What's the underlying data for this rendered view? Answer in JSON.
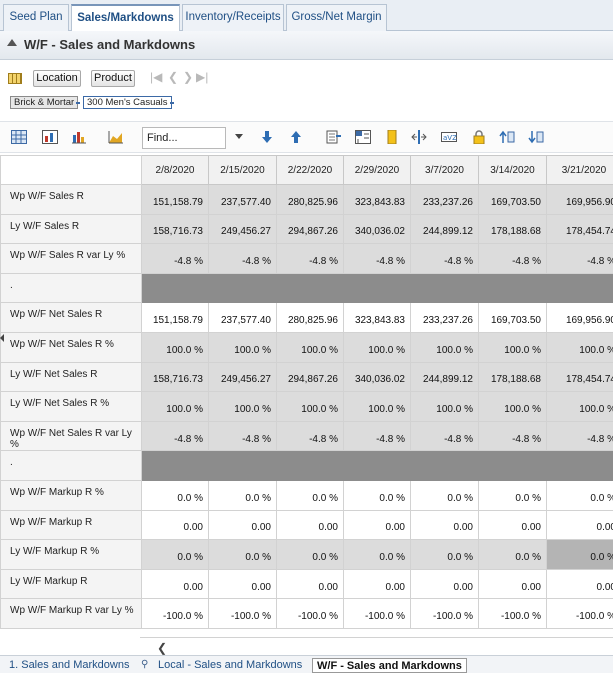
{
  "tabs": [
    {
      "label": "Seed Plan"
    },
    {
      "label": "Sales/Markdowns"
    },
    {
      "label": "Inventory/Receipts"
    },
    {
      "label": "Gross/Net Margin"
    }
  ],
  "title": "W/F - Sales and Markdowns",
  "selectors": {
    "location_label": "Location",
    "product_label": "Product",
    "breadcrumbs": [
      "Brick & Mortar",
      "300 Men's Casuals"
    ]
  },
  "toolbar": {
    "find_value": "Find...",
    "icons": [
      "grid-view-icon",
      "chart-view-icon",
      "bar-chart-icon",
      "area-chart-icon",
      "find-dropdown-icon",
      "move-down-icon",
      "move-up-icon",
      "export-icon",
      "pivot-icon",
      "highlight-icon",
      "split-icon",
      "calc-icon",
      "lock-icon",
      "expand-icon",
      "collapse-icon"
    ]
  },
  "grid": {
    "columns": [
      "2/8/2020",
      "2/15/2020",
      "2/22/2020",
      "2/29/2020",
      "3/7/2020",
      "3/14/2020",
      "3/21/2020"
    ],
    "rows": [
      {
        "label": "Wp W/F Sales R",
        "values": [
          "151,158.79",
          "237,577.40",
          "280,825.96",
          "323,843.83",
          "233,237.26",
          "169,703.50",
          "169,956.90"
        ]
      },
      {
        "label": "Ly W/F Sales R",
        "values": [
          "158,716.73",
          "249,456.27",
          "294,867.26",
          "340,036.02",
          "244,899.12",
          "178,188.68",
          "178,454.74"
        ]
      },
      {
        "label": "Wp W/F Sales R var Ly %",
        "values": [
          "-4.8 %",
          "-4.8 %",
          "-4.8 %",
          "-4.8 %",
          "-4.8 %",
          "-4.8 %",
          "-4.8 %"
        ]
      },
      {
        "label": ".",
        "values": [
          "",
          "",
          "",
          "",
          "",
          "",
          ""
        ]
      },
      {
        "label": "Wp W/F Net Sales R",
        "values": [
          "151,158.79",
          "237,577.40",
          "280,825.96",
          "323,843.83",
          "233,237.26",
          "169,703.50",
          "169,956.90"
        ]
      },
      {
        "label": "Wp W/F Net Sales R %",
        "values": [
          "100.0 %",
          "100.0 %",
          "100.0 %",
          "100.0 %",
          "100.0 %",
          "100.0 %",
          "100.0 %"
        ]
      },
      {
        "label": "Ly W/F Net Sales R",
        "values": [
          "158,716.73",
          "249,456.27",
          "294,867.26",
          "340,036.02",
          "244,899.12",
          "178,188.68",
          "178,454.74"
        ]
      },
      {
        "label": "Ly W/F Net Sales R %",
        "values": [
          "100.0 %",
          "100.0 %",
          "100.0 %",
          "100.0 %",
          "100.0 %",
          "100.0 %",
          "100.0 %"
        ]
      },
      {
        "label": "Wp W/F Net Sales R var Ly %",
        "values": [
          "-4.8 %",
          "-4.8 %",
          "-4.8 %",
          "-4.8 %",
          "-4.8 %",
          "-4.8 %",
          "-4.8 %"
        ]
      },
      {
        "label": ".",
        "values": [
          "",
          "",
          "",
          "",
          "",
          "",
          ""
        ]
      },
      {
        "label": "Wp W/F Markup R %",
        "values": [
          "0.0 %",
          "0.0 %",
          "0.0 %",
          "0.0 %",
          "0.0 %",
          "0.0 %",
          "0.0 %"
        ]
      },
      {
        "label": "Wp W/F Markup R",
        "values": [
          "0.00",
          "0.00",
          "0.00",
          "0.00",
          "0.00",
          "0.00",
          "0.00"
        ]
      },
      {
        "label": "Ly W/F Markup R %",
        "values": [
          "0.0 %",
          "0.0 %",
          "0.0 %",
          "0.0 %",
          "0.0 %",
          "0.0 %",
          "0.0 %"
        ]
      },
      {
        "label": "Ly W/F Markup R",
        "values": [
          "0.00",
          "0.00",
          "0.00",
          "0.00",
          "0.00",
          "0.00",
          "0.00"
        ]
      },
      {
        "label": "Wp W/F Markup R var Ly %",
        "values": [
          "-100.0 %",
          "-100.0 %",
          "-100.0 %",
          "-100.0 %",
          "-100.0 %",
          "-100.0 %",
          "-100.0 %"
        ]
      }
    ]
  },
  "bottom_tabs": [
    {
      "label": "1. Sales and Markdowns"
    },
    {
      "label": "Local - Sales and Markdowns"
    },
    {
      "label": "W/F - Sales and Markdowns"
    }
  ],
  "colors": {
    "accent": "#1f4f84",
    "cell_grey": "#dcdcdc",
    "divider_row": "#8c8c8c"
  }
}
